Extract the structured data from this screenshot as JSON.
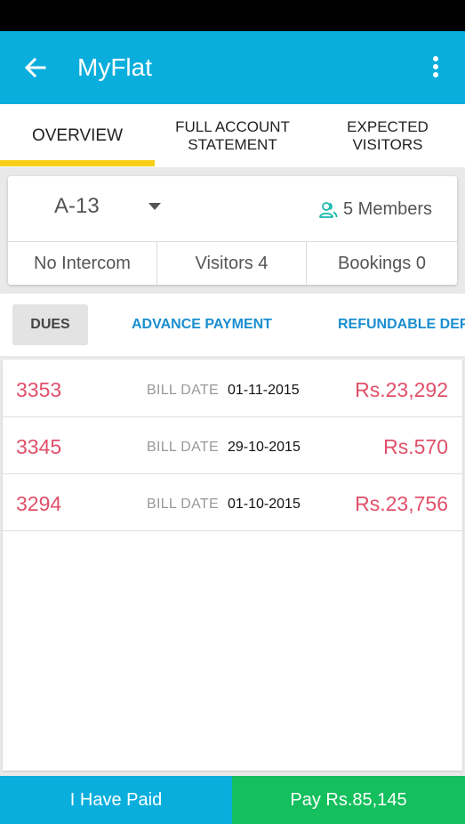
{
  "app": {
    "title": "MyFlat"
  },
  "tabs": [
    {
      "line1": "OVERVIEW",
      "line2": ""
    },
    {
      "line1": "FULL ACCOUNT",
      "line2": "STATEMENT"
    },
    {
      "line1": "EXPECTED",
      "line2": "VISITORS"
    }
  ],
  "flat": {
    "selected": "A-13",
    "members": "5 Members",
    "intercom": "No Intercom",
    "visitors": "Visitors 4",
    "bookings": "Bookings 0"
  },
  "subtabs": {
    "dues": "DUES",
    "advance": "ADVANCE PAYMENT",
    "refundable": "REFUNDABLE DEPOSIT"
  },
  "bills": [
    {
      "number": "3353",
      "label": "BILL DATE",
      "date": "01-11-2015",
      "amount": "Rs.23,292"
    },
    {
      "number": "3345",
      "label": "BILL DATE",
      "date": "29-10-2015",
      "amount": "Rs.570"
    },
    {
      "number": "3294",
      "label": "BILL DATE",
      "date": "01-10-2015",
      "amount": "Rs.23,756"
    }
  ],
  "actions": {
    "paid": "I Have Paid",
    "pay": "Pay Rs.85,145"
  },
  "colors": {
    "primary": "#0aaedc",
    "accent": "#f9cf16",
    "pay": "#14bf5d",
    "due": "#e0506a",
    "link": "#1a8ecf"
  }
}
